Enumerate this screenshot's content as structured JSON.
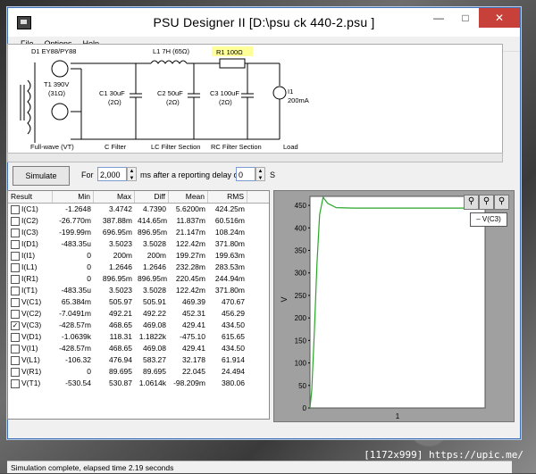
{
  "window": {
    "title": "PSU Designer II  [D:\\psu ck 440-2.psu ]"
  },
  "menu": [
    "File",
    "Options",
    "Help"
  ],
  "schematic": {
    "diode": "D1 EY88/PY88",
    "transformer": "T1 390V",
    "transformer_r": "(31Ω)",
    "inductor": "L1 7H (65Ω)",
    "resistor": "R1 100Ω",
    "c1": "C1 30uF",
    "c1_r": "(2Ω)",
    "c2": "C2 50uF",
    "c2_r": "(2Ω)",
    "c3": "C3 100uF",
    "c3_r": "(2Ω)",
    "load": "I1",
    "load_val": "200mA",
    "sections": [
      "Full-wave (VT)",
      "C Filter",
      "LC Filter Section",
      "RC Filter Section",
      "Load"
    ]
  },
  "controls": {
    "simulate": "Simulate",
    "for": "For",
    "duration": "2,000",
    "ms_after": "ms  after a reporting delay of",
    "delay": "0",
    "s": "S"
  },
  "table": {
    "headers": [
      "Result",
      "Min",
      "Max",
      "Diff",
      "Mean",
      "RMS"
    ],
    "rows": [
      {
        "name": "I(C1)",
        "checked": false,
        "min": "-1.2648",
        "max": "3.4742",
        "diff": "4.7390",
        "mean": "5.6200m",
        "rms": "424.25m"
      },
      {
        "name": "I(C2)",
        "checked": false,
        "min": "-26.770m",
        "max": "387.88m",
        "diff": "414.65m",
        "mean": "11.837m",
        "rms": "60.516m"
      },
      {
        "name": "I(C3)",
        "checked": false,
        "min": "-199.99m",
        "max": "696.95m",
        "diff": "896.95m",
        "mean": "21.147m",
        "rms": "108.24m"
      },
      {
        "name": "I(D1)",
        "checked": false,
        "min": "-483.35u",
        "max": "3.5023",
        "diff": "3.5028",
        "mean": "122.42m",
        "rms": "371.80m"
      },
      {
        "name": "I(I1)",
        "checked": false,
        "min": "0",
        "max": "200m",
        "diff": "200m",
        "mean": "199.27m",
        "rms": "199.63m"
      },
      {
        "name": "I(L1)",
        "checked": false,
        "min": "0",
        "max": "1.2646",
        "diff": "1.2646",
        "mean": "232.28m",
        "rms": "283.53m"
      },
      {
        "name": "I(R1)",
        "checked": false,
        "min": "0",
        "max": "896.95m",
        "diff": "896.95m",
        "mean": "220.45m",
        "rms": "244.94m"
      },
      {
        "name": "I(T1)",
        "checked": false,
        "min": "-483.35u",
        "max": "3.5023",
        "diff": "3.5028",
        "mean": "122.42m",
        "rms": "371.80m"
      },
      {
        "name": "V(C1)",
        "checked": false,
        "min": "65.384m",
        "max": "505.97",
        "diff": "505.91",
        "mean": "469.39",
        "rms": "470.67"
      },
      {
        "name": "V(C2)",
        "checked": false,
        "min": "-7.0491m",
        "max": "492.21",
        "diff": "492.22",
        "mean": "452.31",
        "rms": "456.29"
      },
      {
        "name": "V(C3)",
        "checked": true,
        "min": "-428.57m",
        "max": "468.65",
        "diff": "469.08",
        "mean": "429.41",
        "rms": "434.50"
      },
      {
        "name": "V(D1)",
        "checked": false,
        "min": "-1.0639k",
        "max": "118.31",
        "diff": "1.1822k",
        "mean": "-475.10",
        "rms": "615.65"
      },
      {
        "name": "V(I1)",
        "checked": false,
        "min": "-428.57m",
        "max": "468.65",
        "diff": "469.08",
        "mean": "429.41",
        "rms": "434.50"
      },
      {
        "name": "V(L1)",
        "checked": false,
        "min": "-106.32",
        "max": "476.94",
        "diff": "583.27",
        "mean": "32.178",
        "rms": "61.914"
      },
      {
        "name": "V(R1)",
        "checked": false,
        "min": "0",
        "max": "89.695",
        "diff": "89.695",
        "mean": "22.045",
        "rms": "24.494"
      },
      {
        "name": "V(T1)",
        "checked": false,
        "min": "-530.54",
        "max": "530.87",
        "diff": "1.0614k",
        "mean": "-98.209m",
        "rms": "380.06"
      }
    ]
  },
  "plot": {
    "legend": "V(C3)",
    "ylabel": "V",
    "xtick": "1",
    "yticks": [
      "450",
      "400",
      "350",
      "300",
      "250",
      "200",
      "150",
      "100",
      "50",
      "0"
    ]
  },
  "chart_data": {
    "type": "line",
    "title": "",
    "ylabel": "V",
    "ylim": [
      0,
      470
    ],
    "series": [
      {
        "name": "V(C3)",
        "x": [
          0,
          0.02,
          0.05,
          0.08,
          0.11,
          0.15,
          0.2,
          0.3,
          0.5,
          1,
          1.5,
          2
        ],
        "y": [
          0,
          40,
          170,
          320,
          430,
          468,
          455,
          445,
          444,
          444,
          444,
          444
        ]
      }
    ],
    "xticks": [
      "1"
    ]
  },
  "status": "Simulation complete, elapsed time 2.19 seconds",
  "caption": "[1172x999] https://upic.me/"
}
